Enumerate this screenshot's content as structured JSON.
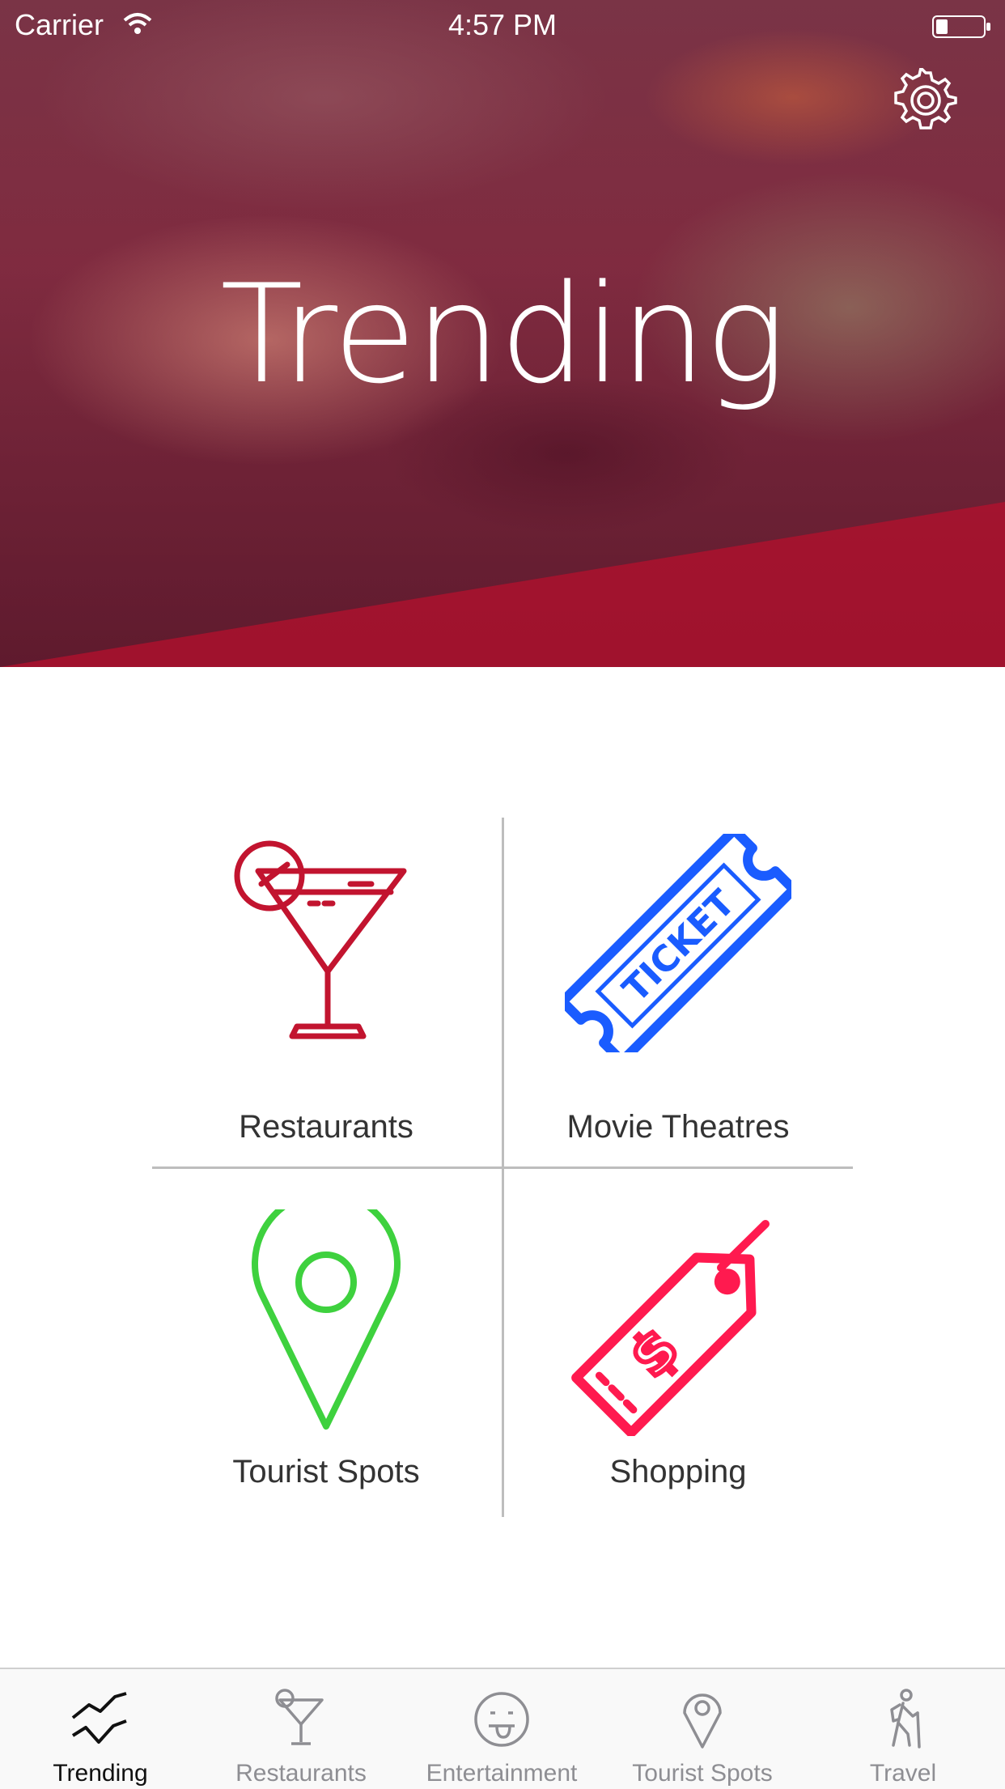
{
  "status_bar": {
    "carrier": "Carrier",
    "time": "4:57 PM"
  },
  "hero": {
    "title": "Trending"
  },
  "categories": [
    {
      "label": "Restaurants",
      "icon": "cocktail-icon",
      "color": "#c2142f"
    },
    {
      "label": "Movie Theatres",
      "icon": "ticket-icon",
      "color": "#1a5cff",
      "icon_text": "TICKET"
    },
    {
      "label": "Tourist Spots",
      "icon": "map-pin-icon",
      "color": "#3ed13e"
    },
    {
      "label": "Shopping",
      "icon": "price-tag-icon",
      "color": "#ff1a4f"
    }
  ],
  "tab_bar": {
    "active_color": "#111111",
    "inactive_color": "#8e8e93",
    "items": [
      {
        "label": "Trending",
        "icon": "trending-icon",
        "active": true
      },
      {
        "label": "Restaurants",
        "icon": "cocktail-icon",
        "active": false
      },
      {
        "label": "Entertainment",
        "icon": "smiley-tongue-icon",
        "active": false
      },
      {
        "label": "Tourist Spots",
        "icon": "map-pin-icon",
        "active": false
      },
      {
        "label": "Travel",
        "icon": "hiker-icon",
        "active": false
      }
    ]
  }
}
